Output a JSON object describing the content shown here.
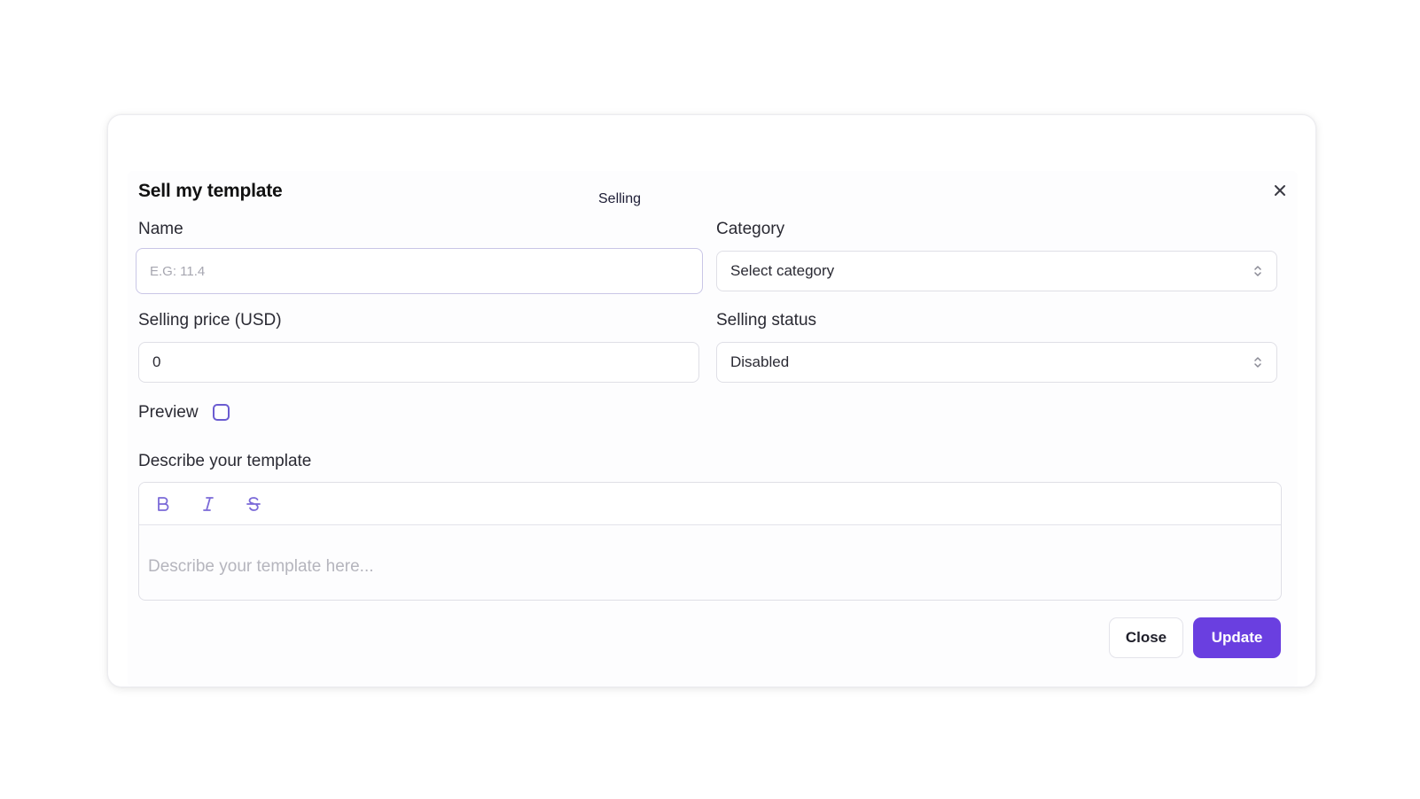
{
  "modal": {
    "title": "Sell my template",
    "tab_label": "Selling"
  },
  "form": {
    "name": {
      "label": "Name",
      "placeholder": "E.G: 11.4",
      "value": ""
    },
    "category": {
      "label": "Category",
      "selected": "Select category"
    },
    "price": {
      "label": "Selling price (USD)",
      "value": "0"
    },
    "status": {
      "label": "Selling status",
      "selected": "Disabled"
    },
    "preview": {
      "label": "Preview",
      "checked": false
    },
    "description": {
      "label": "Describe your template",
      "placeholder": "Describe your template here...",
      "toolbar": [
        "bold-icon",
        "italic-icon",
        "strikethrough-icon"
      ]
    }
  },
  "actions": {
    "close_label": "Close",
    "update_label": "Update"
  },
  "colors": {
    "accent": "#6a3fe0",
    "icon_accent": "#7b6ad8",
    "checkbox_border": "#6b5cd1"
  }
}
